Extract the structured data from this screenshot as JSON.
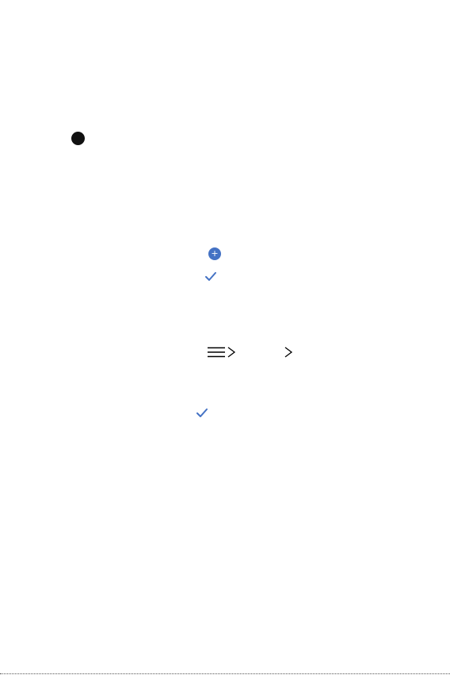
{
  "page": {
    "icons": {
      "bullet": "filled-circle-bullet-icon",
      "add": "plus-circle-icon",
      "check": "checkmark-icon",
      "menu": "hamburger-menu-icon",
      "chevron": "chevron-right-icon"
    },
    "add_icon_glyph": "+",
    "colors": {
      "accent": "#4472c4",
      "text": "#000000",
      "bullet": "#111111"
    }
  }
}
